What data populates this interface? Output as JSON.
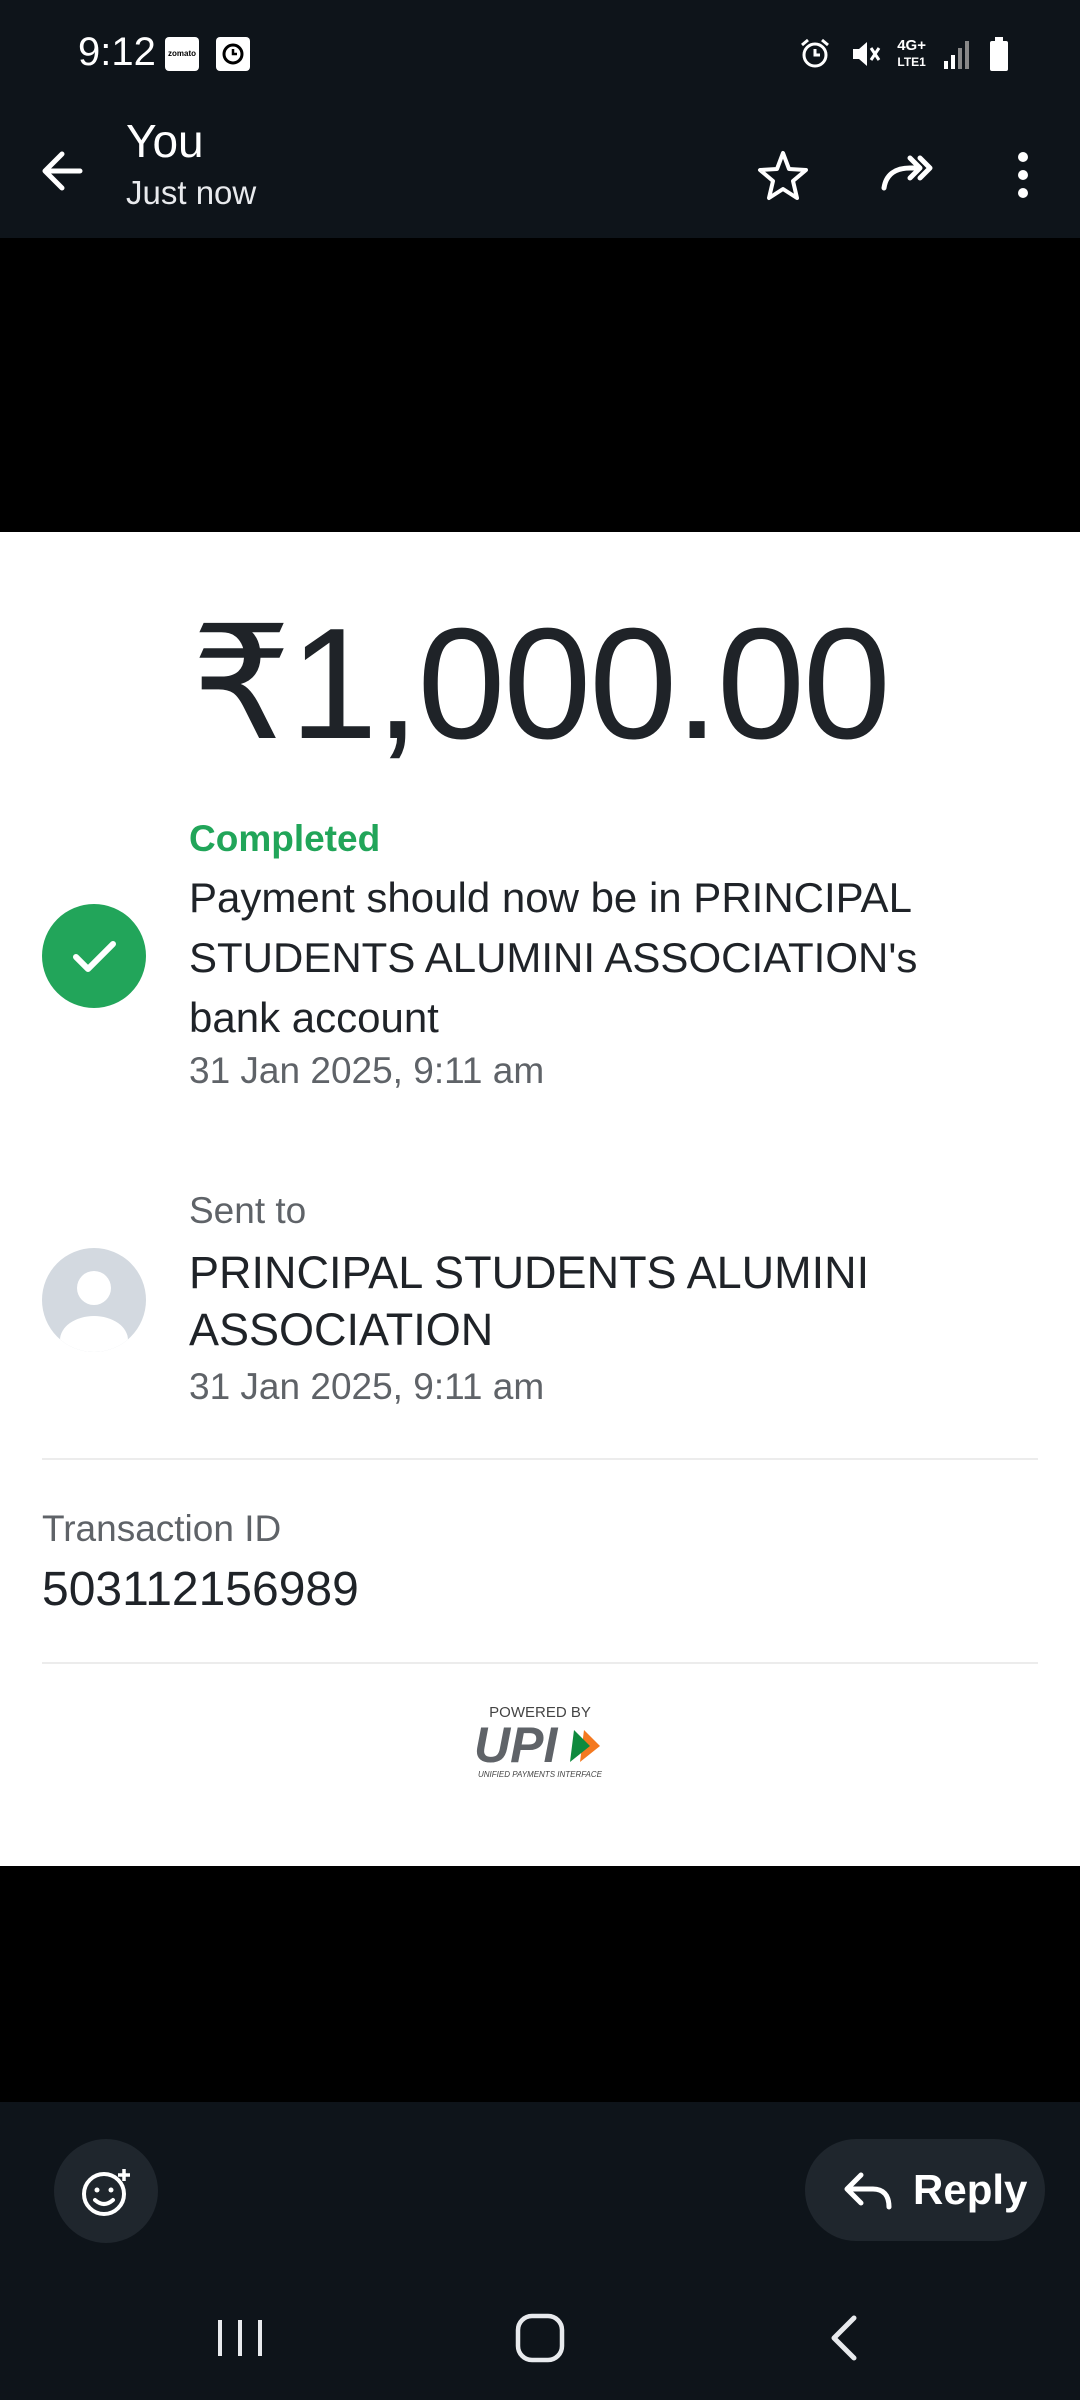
{
  "status_bar": {
    "time": "9:12",
    "app_icons": [
      "zomato",
      "clock-icon"
    ],
    "zomato_text": "zomato",
    "network": {
      "vo_lte": "Vo)) LTE1",
      "gen": "4G+"
    }
  },
  "header": {
    "title": "You",
    "subtitle": "Just now"
  },
  "receipt": {
    "amount": "₹1,000.00",
    "status_label": "Completed",
    "status_message": "Payment should now be in PRINCIPAL STUDENTS ALUMINI ASSOCIATION's bank account",
    "status_time": "31 Jan 2025, 9:11 am",
    "sent_to_label": "Sent to",
    "recipient_name": "PRINCIPAL STUDENTS ALUMINI ASSOCIATION",
    "sent_time": "31 Jan 2025, 9:11 am",
    "transaction_label": "Transaction ID",
    "transaction_id": "503112156989",
    "upi": {
      "powered_by": "POWERED BY",
      "tagline": "UNIFIED PAYMENTS INTERFACE"
    }
  },
  "bottom_bar": {
    "reply_label": "Reply"
  },
  "colors": {
    "bar_bg": "#0e141a",
    "success": "#22a55a",
    "button_bg": "#1f262d"
  }
}
